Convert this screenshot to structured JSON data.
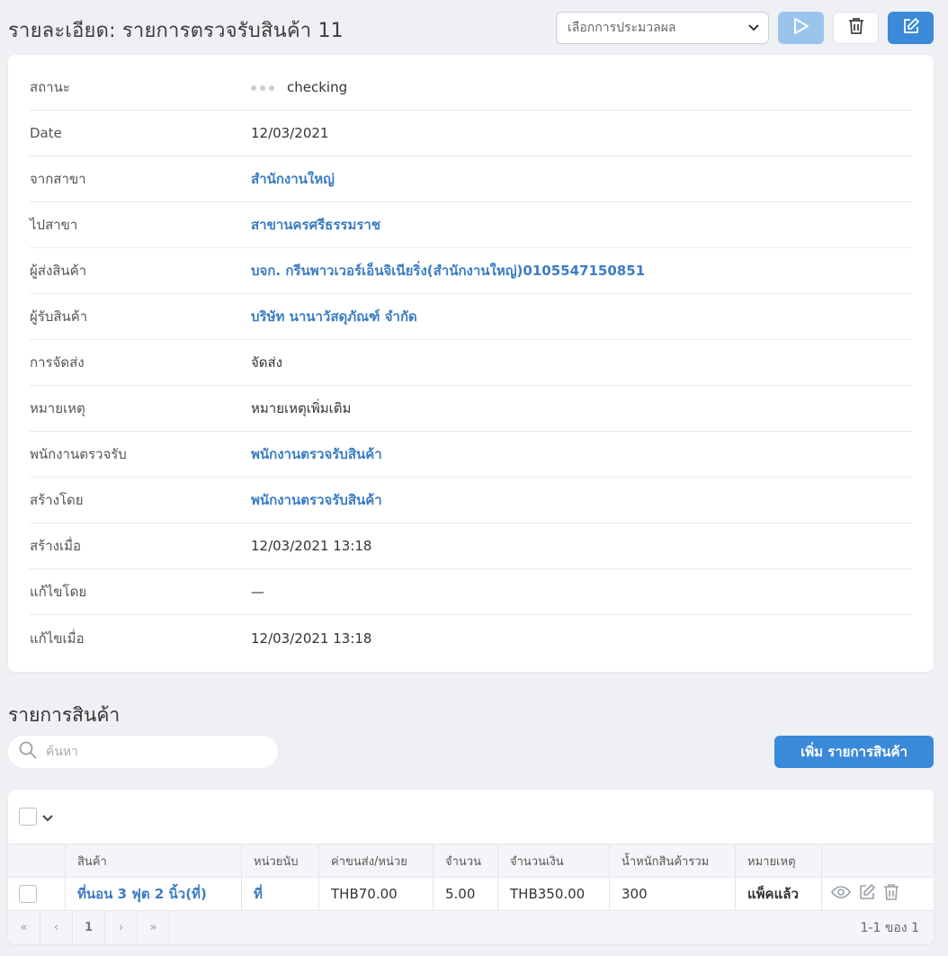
{
  "header": {
    "title": "รายละเอียด: รายการตรวจรับสินค้า 11",
    "process_select": "เลือกการประมวลผล"
  },
  "details": [
    {
      "label": "สถานะ",
      "value": "checking",
      "type": "status"
    },
    {
      "label": "Date",
      "value": "12/03/2021",
      "type": "text"
    },
    {
      "label": "จากสาขา",
      "value": "สำนักงานใหญ่",
      "type": "link"
    },
    {
      "label": "ไปสาขา",
      "value": "สาขานครศรีธรรมราช",
      "type": "link"
    },
    {
      "label": "ผู้ส่งสินค้า",
      "value": "บจก. กรีนพาวเวอร์เอ็นจิเนียริ่ง(สำนักงานใหญ่)0105547150851",
      "type": "link"
    },
    {
      "label": "ผู้รับสินค้า",
      "value": "บริษัท นานาวัสดุภัณฑ์ จำกัด",
      "type": "link"
    },
    {
      "label": "การจัดส่ง",
      "value": "จัดส่ง",
      "type": "text"
    },
    {
      "label": "หมายเหตุ",
      "value": "หมายเหตุเพิ่มเติม",
      "type": "text"
    },
    {
      "label": "พนักงานตรวจรับ",
      "value": "พนักงานตรวจรับสินค้า",
      "type": "link"
    },
    {
      "label": "สร้างโดย",
      "value": "พนักงานตรวจรับสินค้า",
      "type": "link"
    },
    {
      "label": "สร้างเมื่อ",
      "value": "12/03/2021 13:18",
      "type": "text"
    },
    {
      "label": "แก้ไขโดย",
      "value": "—",
      "type": "text"
    },
    {
      "label": "แก้ไขเมื่อ",
      "value": "12/03/2021 13:18",
      "type": "text"
    }
  ],
  "items_section": {
    "title": "รายการสินค้า",
    "search_placeholder": "ค้นหา",
    "add_button": "เพิ่ม รายการสินค้า",
    "columns": [
      "สินค้า",
      "หน่วยนับ",
      "ค่าขนส่ง/หน่วย",
      "จำนวน",
      "จำนวนเงิน",
      "น้ำหนักสินค้ารวม",
      "หมายเหตุ"
    ],
    "rows": [
      {
        "product": "ที่นอน 3 ฟุต 2 นิ้ว(ที่)",
        "unit": "ที่",
        "shipping_per_unit": "THB70.00",
        "qty": "5.00",
        "amount": "THB350.00",
        "total_weight": "300",
        "note": "แพ็คแล้ว"
      }
    ],
    "pager": {
      "first": "«",
      "prev": "‹",
      "current": "1",
      "next": "›",
      "last": "»",
      "info": "1-1 ของ 1"
    }
  },
  "colors": {
    "primary": "#3b8ad9",
    "link": "#3b7dc4",
    "background": "#eef0f4"
  }
}
